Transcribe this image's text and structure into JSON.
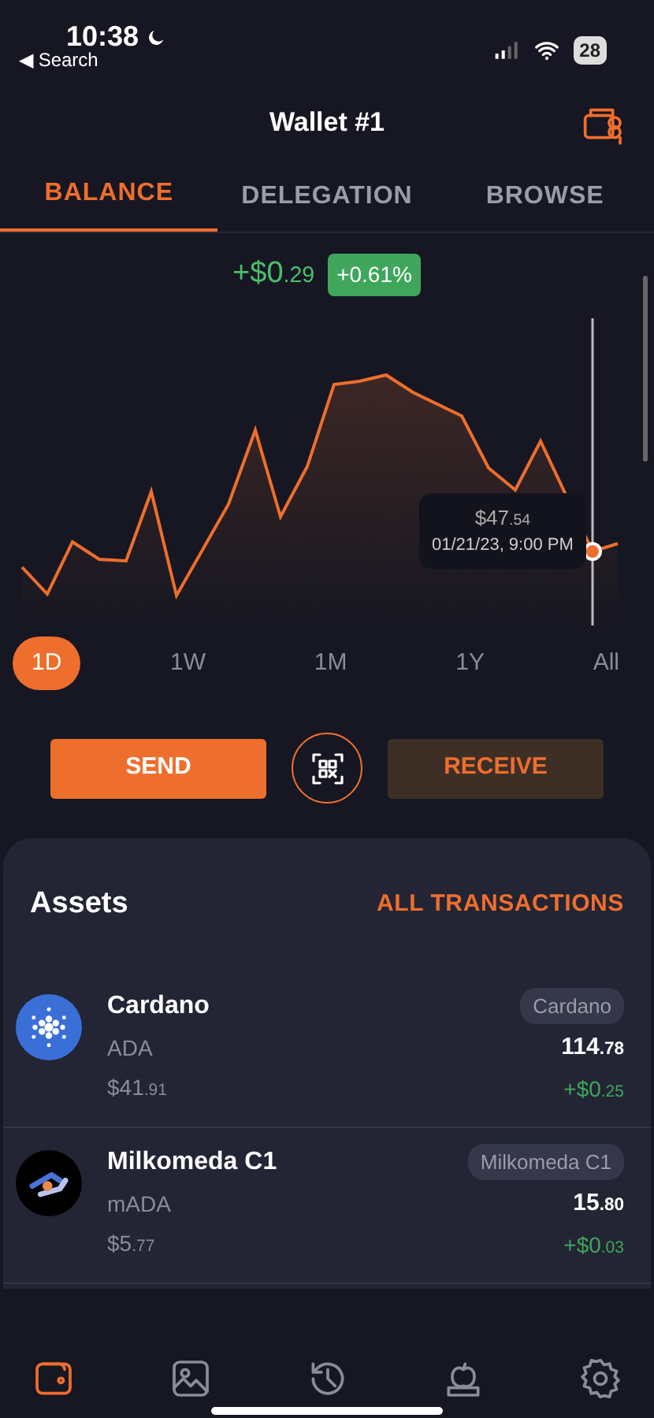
{
  "status_bar": {
    "time": "10:38",
    "back": "◀ Search",
    "battery": "28"
  },
  "header": {
    "title": "Wallet #1"
  },
  "tabs": [
    {
      "label": "BALANCE",
      "selected": true
    },
    {
      "label": "DELEGATION",
      "selected": false
    },
    {
      "label": "BROWSE",
      "selected": false
    }
  ],
  "change": {
    "amount": "+$0",
    "amount_fraction": ".29",
    "percent": "+0.61%"
  },
  "tooltip": {
    "value": "$47",
    "value_fraction": ".54",
    "date": "01/21/23, 9:00 PM"
  },
  "periods": [
    {
      "label": "1D",
      "selected": true
    },
    {
      "label": "1W",
      "selected": false
    },
    {
      "label": "1M",
      "selected": false
    },
    {
      "label": "1Y",
      "selected": false
    },
    {
      "label": "All",
      "selected": false
    }
  ],
  "actions": {
    "send": "SEND",
    "receive": "RECEIVE"
  },
  "assets": {
    "title": "Assets",
    "link": "ALL TRANSACTIONS",
    "items": [
      {
        "kind": "cardano",
        "name": "Cardano",
        "ticker": "ADA",
        "fiat": "$41",
        "fiat_fraction": ".91",
        "network": "Cardano",
        "amount": "114",
        "amount_fraction": ".78",
        "change": "+$0",
        "change_fraction": ".25"
      },
      {
        "kind": "milkomeda",
        "name": "Milkomeda C1",
        "ticker": "mADA",
        "fiat": "$5",
        "fiat_fraction": ".77",
        "network": "Milkomeda C1",
        "amount": "15",
        "amount_fraction": ".80",
        "change": "+$0",
        "change_fraction": ".03"
      }
    ]
  },
  "nav": [
    {
      "kind": "wallet",
      "selected": true
    },
    {
      "kind": "gallery",
      "selected": false
    },
    {
      "kind": "history",
      "selected": false
    },
    {
      "kind": "learn",
      "selected": false
    },
    {
      "kind": "settings",
      "selected": false
    }
  ]
}
